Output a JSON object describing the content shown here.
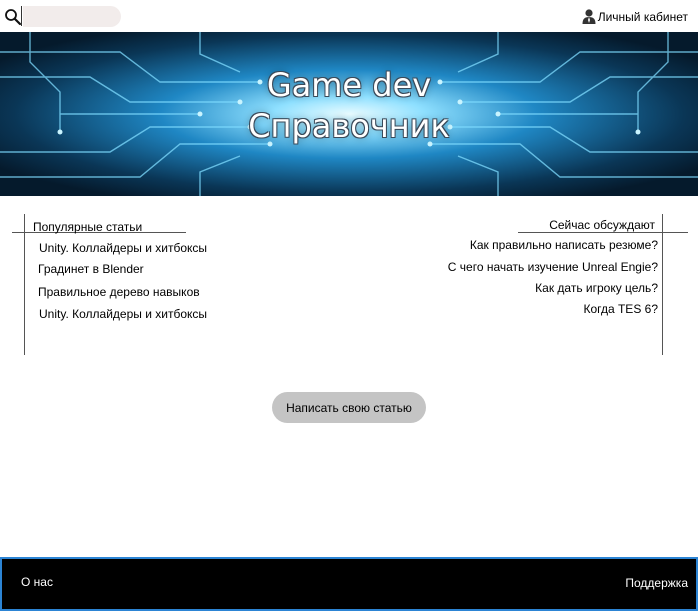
{
  "search": {
    "placeholder": "",
    "value": ""
  },
  "header": {
    "account_label": "Личный кабинет"
  },
  "hero": {
    "title_line1": "Game dev",
    "title_line2": "Справочник"
  },
  "popular": {
    "title": "Популярные статьи",
    "items": [
      "Unity. Коллайдеры и хитбоксы",
      "Градинет в Blender",
      "Правильное дерево навыков",
      "Unity. Коллайдеры и хитбоксы"
    ]
  },
  "discussion": {
    "title": "Сейчас обсуждают",
    "items": [
      "Как правильно написать резюме?",
      "С чего начать изучение Unreal Engie?",
      "Как дать игроку цель?",
      "Когда TES 6?"
    ]
  },
  "actions": {
    "write_article": "Написать свою статью"
  },
  "footer": {
    "about": "О нас",
    "support": "Поддержка"
  },
  "colors": {
    "footer_bg": "#000000",
    "footer_border": "#2c84d4",
    "button_bg": "#c4c4c4",
    "search_bg": "#f2eceb"
  }
}
